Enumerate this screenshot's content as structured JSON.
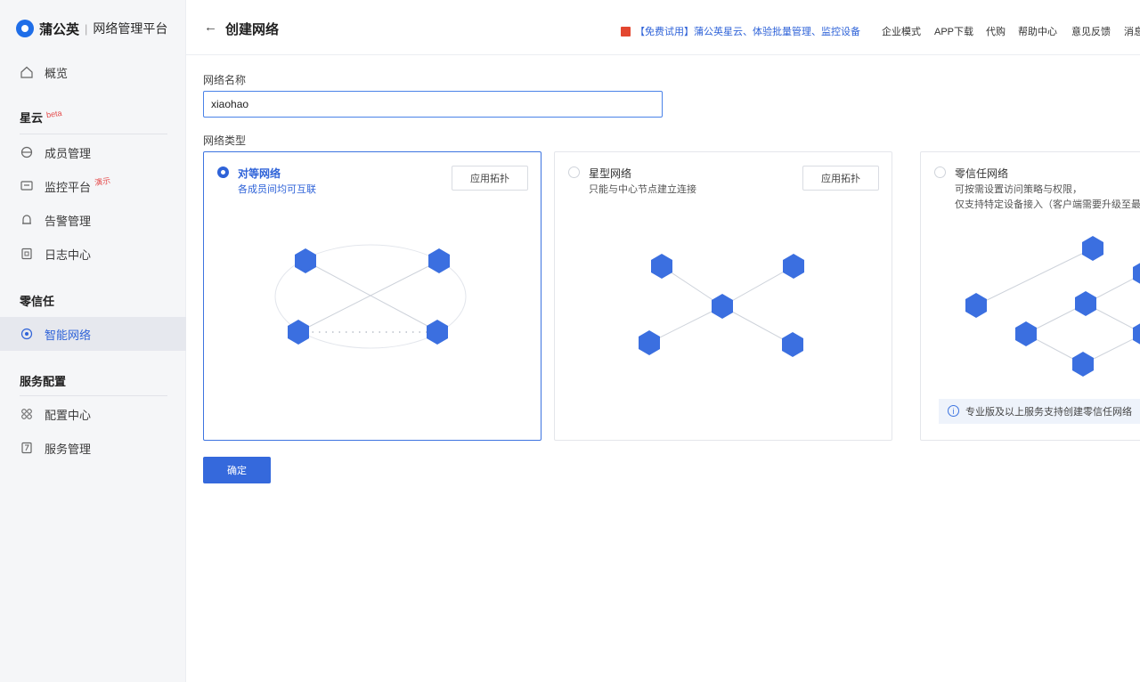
{
  "brand": {
    "name": "蒲公英",
    "separator": "|",
    "subtitle": "网络管理平台"
  },
  "sidebar": {
    "overview": "概览",
    "sections": [
      {
        "title": "星云",
        "tag": "beta"
      },
      {
        "title": "零信任"
      },
      {
        "title": "服务配置"
      }
    ],
    "items": [
      {
        "label": "成员管理",
        "icon": "members-icon"
      },
      {
        "label": "监控平台",
        "icon": "monitor-icon",
        "tag": "演示"
      },
      {
        "label": "告警管理",
        "icon": "bell-icon"
      },
      {
        "label": "日志中心",
        "icon": "log-icon"
      },
      {
        "label": "智能网络",
        "icon": "network-icon",
        "active": true
      },
      {
        "label": "配置中心",
        "icon": "config-icon"
      },
      {
        "label": "服务管理",
        "icon": "service-icon"
      }
    ]
  },
  "header": {
    "back": "←",
    "title": "创建网络",
    "promo": "【免费试用】蒲公英星云、体验批量管理、监控设备",
    "nav": [
      "企业模式",
      "APP下载",
      "代购",
      "帮助中心",
      "意见反馈",
      "消息"
    ]
  },
  "form": {
    "name_label": "网络名称",
    "name_value": "xiaohao",
    "type_label": "网络类型",
    "confirm": "确定"
  },
  "cards": [
    {
      "title": "对等网络",
      "desc": [
        "各成员间均可互联"
      ],
      "button": "应用拓扑",
      "selected": true
    },
    {
      "title": "星型网络",
      "desc": [
        "只能与中心节点建立连接"
      ],
      "button": "应用拓扑",
      "selected": false
    },
    {
      "title": "零信任网络",
      "desc": [
        "可按需设置访问策略与权限，",
        "仅支持特定设备接入（客户端需要升级至最新"
      ],
      "button": "",
      "selected": false,
      "note": "专业版及以上服务支持创建零信任网络"
    }
  ],
  "colors": {
    "accent": "#2f63d8",
    "node": "#3b6fe0",
    "promo_icon": "#e3462f"
  }
}
